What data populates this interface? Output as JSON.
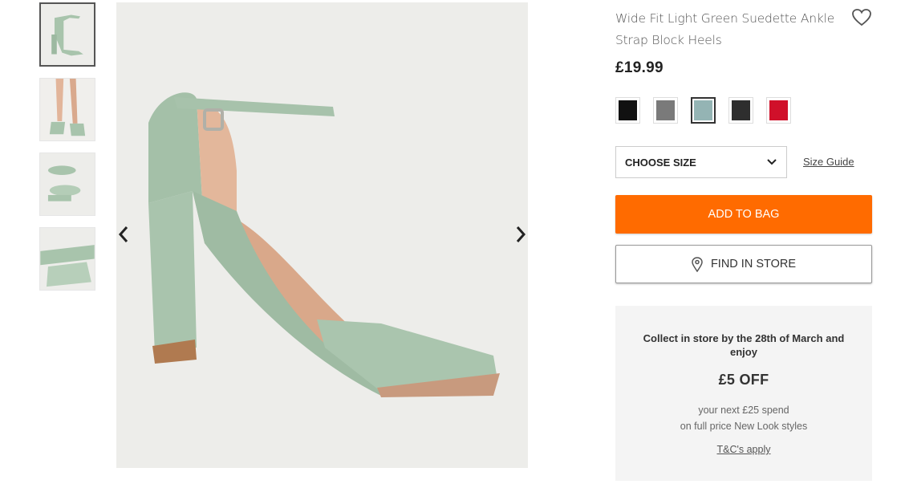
{
  "product": {
    "title": "Wide Fit Light Green Suedette Ankle Strap Block Heels",
    "price": "£19.99"
  },
  "gallery": {
    "thumbnails": [
      {
        "name": "thumb-side-view",
        "active": true
      },
      {
        "name": "thumb-worn-view",
        "active": false
      },
      {
        "name": "thumb-top-view",
        "active": false
      },
      {
        "name": "thumb-detail-view",
        "active": false
      }
    ],
    "main_image_color": "#a8c4ac"
  },
  "icons": {
    "prev": "chevron-left-icon",
    "next": "chevron-right-icon",
    "wishlist": "heart-icon",
    "dropdown": "chevron-down-icon",
    "store": "location-pin-icon"
  },
  "swatches": [
    {
      "name": "black",
      "color": "#111111",
      "selected": false
    },
    {
      "name": "grey",
      "color": "#7a7a7a",
      "selected": false
    },
    {
      "name": "light-green",
      "color": "#94b4b4",
      "selected": true
    },
    {
      "name": "dark-grey",
      "color": "#2e2e2e",
      "selected": false
    },
    {
      "name": "red",
      "color": "#d0102a",
      "selected": false
    }
  ],
  "size": {
    "select_label": "CHOOSE SIZE",
    "guide_label": "Size Guide"
  },
  "buttons": {
    "add_to_bag": "ADD TO BAG",
    "find_in_store": "FIND IN STORE"
  },
  "promo": {
    "heading": "Collect in store by the 28th of March and enjoy",
    "offer": "£5 OFF",
    "line1": "your next £25 spend",
    "line2": "on full price New Look styles",
    "terms": "T&C's apply"
  },
  "colors": {
    "accent": "#ff6b00",
    "promo_bg": "#f4f4f4"
  }
}
